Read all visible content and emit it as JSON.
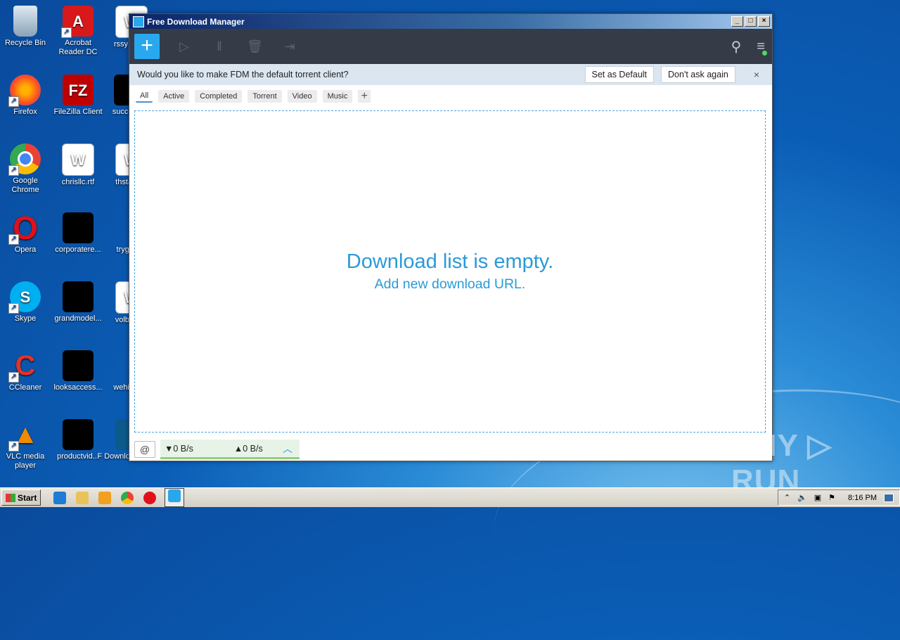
{
  "desktop": {
    "icons": [
      {
        "label": "Recycle Bin"
      },
      {
        "label": "Acrobat Reader DC"
      },
      {
        "label": "rssy"
      },
      {
        "label": "Firefox"
      },
      {
        "label": "FileZilla Client"
      },
      {
        "label": "succes"
      },
      {
        "label": "Google Chrome"
      },
      {
        "label": "chrisllc.rtf"
      },
      {
        "label": "thsta"
      },
      {
        "label": "Opera"
      },
      {
        "label": "corporatere..."
      },
      {
        "label": "tryge"
      },
      {
        "label": "Skype"
      },
      {
        "label": "grandmodel..."
      },
      {
        "label": "volba"
      },
      {
        "label": "CCleaner"
      },
      {
        "label": "looksaccess..."
      },
      {
        "label": "wehig"
      },
      {
        "label": "VLC media player"
      },
      {
        "label": "productvid..."
      },
      {
        "label": "F Downlo..."
      }
    ]
  },
  "window": {
    "title": "Free Download Manager",
    "controls": {
      "minimize": "_",
      "maximize": "□",
      "close": "×"
    }
  },
  "notice": {
    "message": "Would you like to make FDM the default torrent client?",
    "set_default": "Set as Default",
    "dont_ask": "Don't ask again",
    "close": "×"
  },
  "tabs": [
    {
      "label": "All",
      "active": true
    },
    {
      "label": "Active"
    },
    {
      "label": "Completed"
    },
    {
      "label": "Torrent"
    },
    {
      "label": "Video"
    },
    {
      "label": "Music"
    }
  ],
  "tab_add": "+",
  "main": {
    "empty_title": "Download list is empty.",
    "empty_sub": "Add new download URL."
  },
  "status": {
    "download_speed": "▼0 B/s",
    "upload_speed": "▲0 B/s"
  },
  "taskbar": {
    "start_label": "Start",
    "clock": "8:16 PM"
  },
  "watermark": "ANY ▷ RUN",
  "colors": {
    "accent": "#29a8ef",
    "toolbar": "#353b47",
    "notice_bg": "#dbe6f1"
  }
}
